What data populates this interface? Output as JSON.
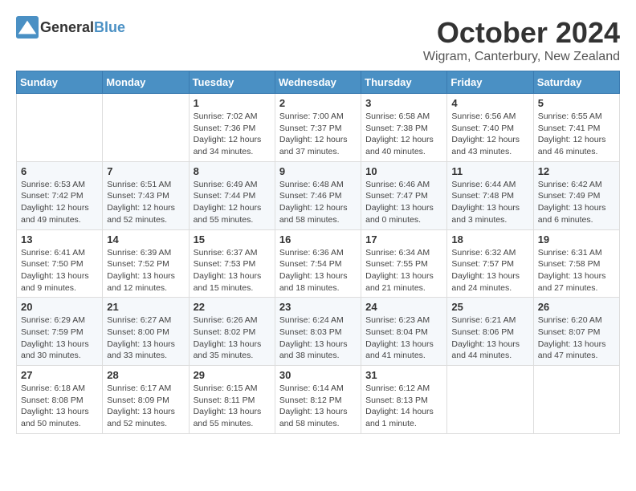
{
  "header": {
    "logo_line1": "General",
    "logo_line2": "Blue",
    "month_title": "October 2024",
    "subtitle": "Wigram, Canterbury, New Zealand"
  },
  "weekdays": [
    "Sunday",
    "Monday",
    "Tuesday",
    "Wednesday",
    "Thursday",
    "Friday",
    "Saturday"
  ],
  "weeks": [
    [
      {
        "day": "",
        "sunrise": "",
        "sunset": "",
        "daylight": ""
      },
      {
        "day": "",
        "sunrise": "",
        "sunset": "",
        "daylight": ""
      },
      {
        "day": "1",
        "sunrise": "Sunrise: 7:02 AM",
        "sunset": "Sunset: 7:36 PM",
        "daylight": "Daylight: 12 hours and 34 minutes."
      },
      {
        "day": "2",
        "sunrise": "Sunrise: 7:00 AM",
        "sunset": "Sunset: 7:37 PM",
        "daylight": "Daylight: 12 hours and 37 minutes."
      },
      {
        "day": "3",
        "sunrise": "Sunrise: 6:58 AM",
        "sunset": "Sunset: 7:38 PM",
        "daylight": "Daylight: 12 hours and 40 minutes."
      },
      {
        "day": "4",
        "sunrise": "Sunrise: 6:56 AM",
        "sunset": "Sunset: 7:40 PM",
        "daylight": "Daylight: 12 hours and 43 minutes."
      },
      {
        "day": "5",
        "sunrise": "Sunrise: 6:55 AM",
        "sunset": "Sunset: 7:41 PM",
        "daylight": "Daylight: 12 hours and 46 minutes."
      }
    ],
    [
      {
        "day": "6",
        "sunrise": "Sunrise: 6:53 AM",
        "sunset": "Sunset: 7:42 PM",
        "daylight": "Daylight: 12 hours and 49 minutes."
      },
      {
        "day": "7",
        "sunrise": "Sunrise: 6:51 AM",
        "sunset": "Sunset: 7:43 PM",
        "daylight": "Daylight: 12 hours and 52 minutes."
      },
      {
        "day": "8",
        "sunrise": "Sunrise: 6:49 AM",
        "sunset": "Sunset: 7:44 PM",
        "daylight": "Daylight: 12 hours and 55 minutes."
      },
      {
        "day": "9",
        "sunrise": "Sunrise: 6:48 AM",
        "sunset": "Sunset: 7:46 PM",
        "daylight": "Daylight: 12 hours and 58 minutes."
      },
      {
        "day": "10",
        "sunrise": "Sunrise: 6:46 AM",
        "sunset": "Sunset: 7:47 PM",
        "daylight": "Daylight: 13 hours and 0 minutes."
      },
      {
        "day": "11",
        "sunrise": "Sunrise: 6:44 AM",
        "sunset": "Sunset: 7:48 PM",
        "daylight": "Daylight: 13 hours and 3 minutes."
      },
      {
        "day": "12",
        "sunrise": "Sunrise: 6:42 AM",
        "sunset": "Sunset: 7:49 PM",
        "daylight": "Daylight: 13 hours and 6 minutes."
      }
    ],
    [
      {
        "day": "13",
        "sunrise": "Sunrise: 6:41 AM",
        "sunset": "Sunset: 7:50 PM",
        "daylight": "Daylight: 13 hours and 9 minutes."
      },
      {
        "day": "14",
        "sunrise": "Sunrise: 6:39 AM",
        "sunset": "Sunset: 7:52 PM",
        "daylight": "Daylight: 13 hours and 12 minutes."
      },
      {
        "day": "15",
        "sunrise": "Sunrise: 6:37 AM",
        "sunset": "Sunset: 7:53 PM",
        "daylight": "Daylight: 13 hours and 15 minutes."
      },
      {
        "day": "16",
        "sunrise": "Sunrise: 6:36 AM",
        "sunset": "Sunset: 7:54 PM",
        "daylight": "Daylight: 13 hours and 18 minutes."
      },
      {
        "day": "17",
        "sunrise": "Sunrise: 6:34 AM",
        "sunset": "Sunset: 7:55 PM",
        "daylight": "Daylight: 13 hours and 21 minutes."
      },
      {
        "day": "18",
        "sunrise": "Sunrise: 6:32 AM",
        "sunset": "Sunset: 7:57 PM",
        "daylight": "Daylight: 13 hours and 24 minutes."
      },
      {
        "day": "19",
        "sunrise": "Sunrise: 6:31 AM",
        "sunset": "Sunset: 7:58 PM",
        "daylight": "Daylight: 13 hours and 27 minutes."
      }
    ],
    [
      {
        "day": "20",
        "sunrise": "Sunrise: 6:29 AM",
        "sunset": "Sunset: 7:59 PM",
        "daylight": "Daylight: 13 hours and 30 minutes."
      },
      {
        "day": "21",
        "sunrise": "Sunrise: 6:27 AM",
        "sunset": "Sunset: 8:00 PM",
        "daylight": "Daylight: 13 hours and 33 minutes."
      },
      {
        "day": "22",
        "sunrise": "Sunrise: 6:26 AM",
        "sunset": "Sunset: 8:02 PM",
        "daylight": "Daylight: 13 hours and 35 minutes."
      },
      {
        "day": "23",
        "sunrise": "Sunrise: 6:24 AM",
        "sunset": "Sunset: 8:03 PM",
        "daylight": "Daylight: 13 hours and 38 minutes."
      },
      {
        "day": "24",
        "sunrise": "Sunrise: 6:23 AM",
        "sunset": "Sunset: 8:04 PM",
        "daylight": "Daylight: 13 hours and 41 minutes."
      },
      {
        "day": "25",
        "sunrise": "Sunrise: 6:21 AM",
        "sunset": "Sunset: 8:06 PM",
        "daylight": "Daylight: 13 hours and 44 minutes."
      },
      {
        "day": "26",
        "sunrise": "Sunrise: 6:20 AM",
        "sunset": "Sunset: 8:07 PM",
        "daylight": "Daylight: 13 hours and 47 minutes."
      }
    ],
    [
      {
        "day": "27",
        "sunrise": "Sunrise: 6:18 AM",
        "sunset": "Sunset: 8:08 PM",
        "daylight": "Daylight: 13 hours and 50 minutes."
      },
      {
        "day": "28",
        "sunrise": "Sunrise: 6:17 AM",
        "sunset": "Sunset: 8:09 PM",
        "daylight": "Daylight: 13 hours and 52 minutes."
      },
      {
        "day": "29",
        "sunrise": "Sunrise: 6:15 AM",
        "sunset": "Sunset: 8:11 PM",
        "daylight": "Daylight: 13 hours and 55 minutes."
      },
      {
        "day": "30",
        "sunrise": "Sunrise: 6:14 AM",
        "sunset": "Sunset: 8:12 PM",
        "daylight": "Daylight: 13 hours and 58 minutes."
      },
      {
        "day": "31",
        "sunrise": "Sunrise: 6:12 AM",
        "sunset": "Sunset: 8:13 PM",
        "daylight": "Daylight: 14 hours and 1 minute."
      },
      {
        "day": "",
        "sunrise": "",
        "sunset": "",
        "daylight": ""
      },
      {
        "day": "",
        "sunrise": "",
        "sunset": "",
        "daylight": ""
      }
    ]
  ]
}
